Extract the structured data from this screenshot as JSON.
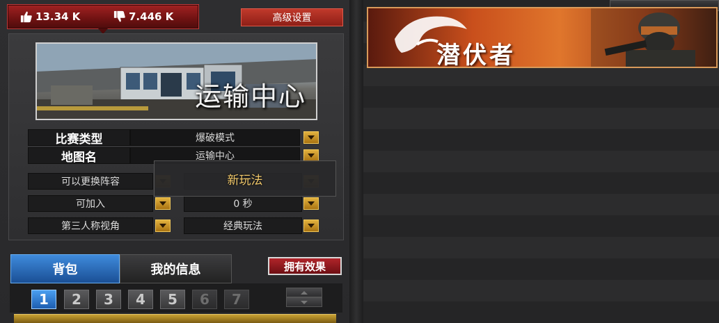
{
  "rating": {
    "likes": "13.34 K",
    "dislikes": "7.446 K",
    "like_icon": "thumbs-up-icon",
    "dislike_icon": "thumbs-down-icon"
  },
  "header": {
    "advanced_settings_label": "高级设置"
  },
  "map": {
    "name_overlay": "运输中心"
  },
  "settings": {
    "match_type_label": "比赛类型",
    "match_type_value": "爆破模式",
    "map_name_label": "地图名",
    "map_name_value": "运输中心"
  },
  "options": {
    "team_change": "可以更换阵容",
    "joinable": "可加入",
    "timer": "0 秒",
    "third_person": "第三人称视角",
    "classic_mode": "经典玩法"
  },
  "tooltip": {
    "text": "新玩法"
  },
  "tabs": {
    "backpack": "背包",
    "my_info": "我的信息"
  },
  "effects_button_label": "拥有效果",
  "pages": [
    "1",
    "2",
    "3",
    "4",
    "5",
    "6",
    "7"
  ],
  "active_page": "1",
  "disabled_pages": [
    "6",
    "7"
  ],
  "mode_banner": {
    "title": "潜伏者",
    "emblem_icon": "tiger-emblem-icon"
  },
  "colors": {
    "accent_red": "#a22222",
    "accent_blue": "#3f8bdc",
    "gold": "#e2b23e",
    "banner_orange": "#e0762c"
  }
}
